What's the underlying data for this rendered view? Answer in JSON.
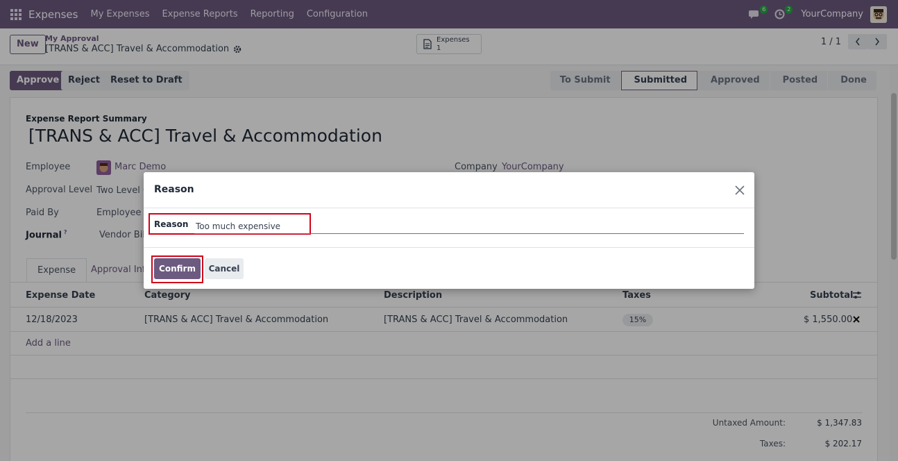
{
  "navbar": {
    "brand": "Expenses",
    "menu": [
      "My Expenses",
      "Expense Reports",
      "Reporting",
      "Configuration"
    ],
    "chat_count": "6",
    "activity_count": "2",
    "company": "YourCompany"
  },
  "control": {
    "new_label": "New",
    "breadcrumb_parent": "My Approval",
    "breadcrumb_current": "[TRANS & ACC] Travel & Accommodation",
    "smart_label": "Expenses",
    "smart_count": "1",
    "pager": "1 / 1"
  },
  "actions": {
    "approve": "Approve",
    "reject": "Reject",
    "reset": "Reset to Draft"
  },
  "stages": [
    "To Submit",
    "Submitted",
    "Approved",
    "Posted",
    "Done"
  ],
  "active_stage": "Submitted",
  "form": {
    "summary_label": "Expense Report Summary",
    "title": "[TRANS & ACC] Travel & Accommodation",
    "employee_label": "Employee",
    "employee_value": "Marc Demo",
    "approval_label": "Approval Level",
    "approval_value": "Two Level Co",
    "paid_by_label": "Paid By",
    "paid_by_value": "Employee (t",
    "journal_label": "Journal",
    "journal_help": "?",
    "journal_value": "Vendor Bills",
    "company_label": "Company",
    "company_value": "YourCompany"
  },
  "tabs": [
    "Expense",
    "Approval Info"
  ],
  "table": {
    "headers": [
      "Expense Date",
      "Category",
      "Description",
      "Taxes",
      "Subtotal"
    ],
    "rows": [
      {
        "date": "12/18/2023",
        "category": "[TRANS & ACC] Travel & Accommodation",
        "description": "[TRANS & ACC] Travel & Accommodation",
        "taxes": "15%",
        "subtotal": "$ 1,550.00"
      }
    ],
    "add_line": "Add a line"
  },
  "totals": {
    "untaxed_label": "Untaxed Amount:",
    "untaxed_value": "$ 1,347.83",
    "taxes_label": "Taxes:",
    "taxes_value": "$ 202.17"
  },
  "dialog": {
    "title": "Reason",
    "field_label": "Reason",
    "field_value": "Too much expensive",
    "confirm": "Confirm",
    "cancel": "Cancel"
  },
  "colors": {
    "primary": "#6c5a80",
    "highlight": "#d0021b"
  }
}
